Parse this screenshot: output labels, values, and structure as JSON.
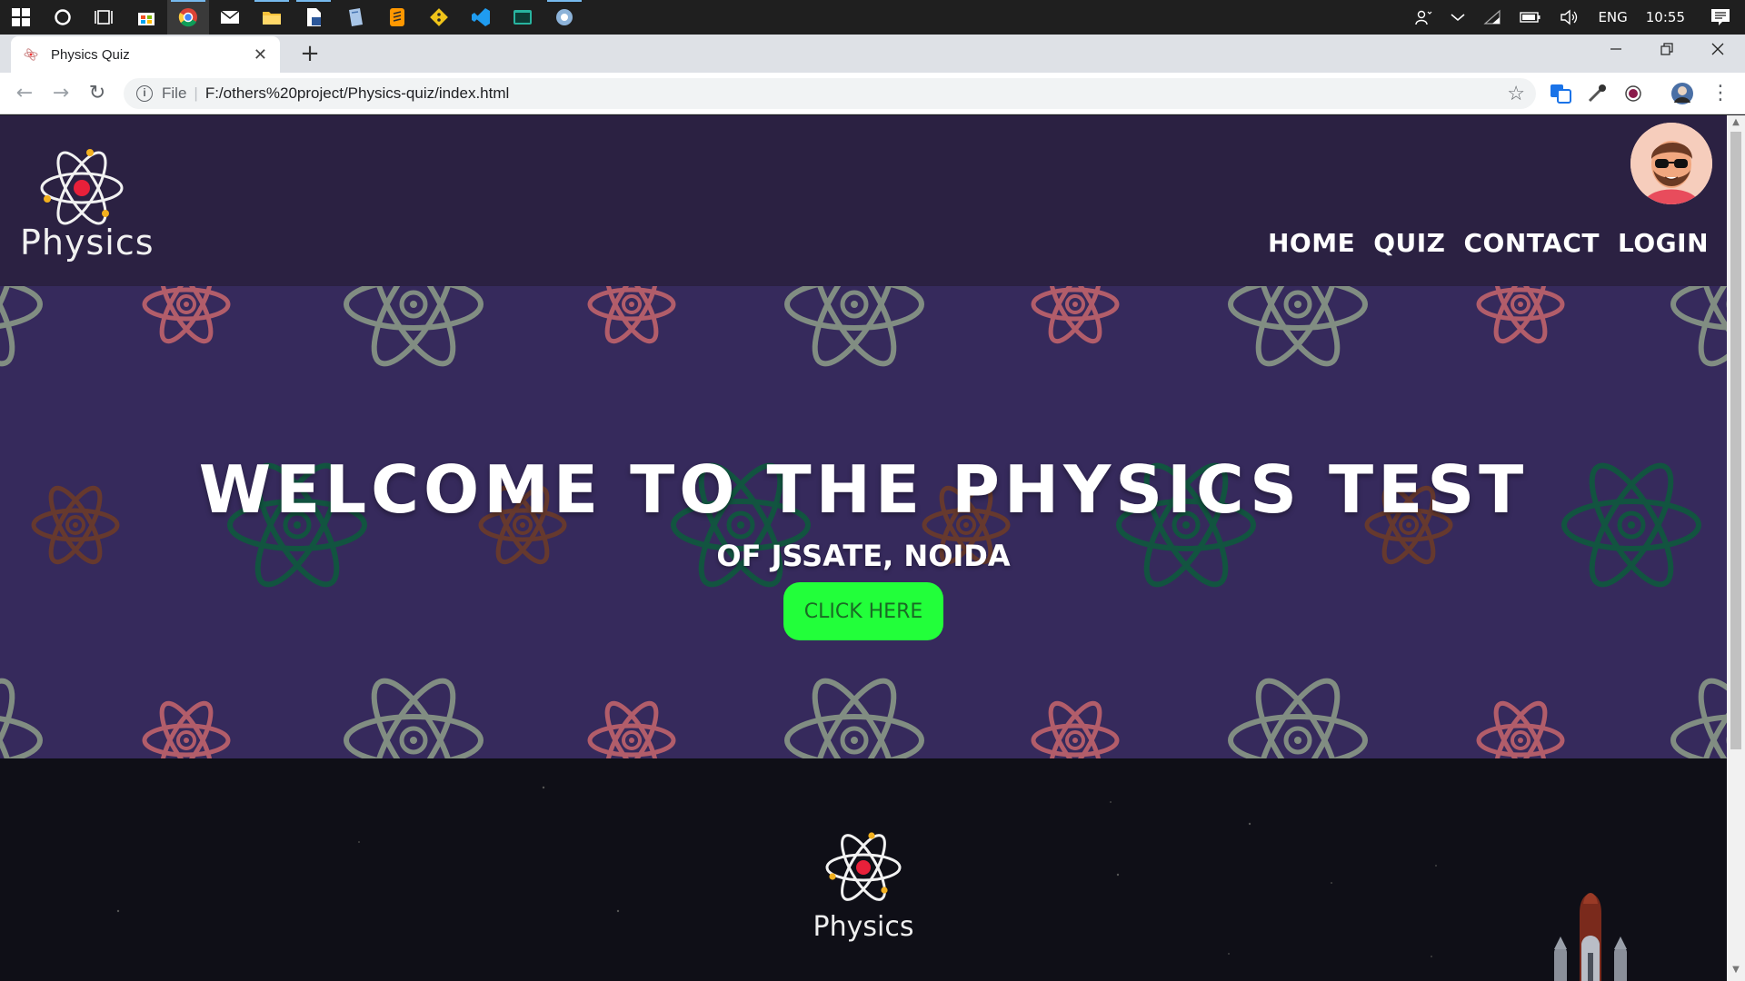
{
  "taskbar": {
    "apps": [
      {
        "icon": "windows-start-icon"
      },
      {
        "icon": "cortana-icon"
      },
      {
        "icon": "task-view-icon"
      },
      {
        "icon": "store-icon"
      },
      {
        "icon": "chrome-icon"
      },
      {
        "icon": "mail-icon"
      },
      {
        "icon": "file-explorer-icon"
      },
      {
        "icon": "document-app-icon"
      },
      {
        "icon": "notes-app-icon"
      },
      {
        "icon": "sublime-text-icon"
      },
      {
        "icon": "git-icon"
      },
      {
        "icon": "vscode-icon"
      },
      {
        "icon": "terminal-app-icon"
      },
      {
        "icon": "settings-app-icon"
      }
    ],
    "tray": {
      "language": "ENG",
      "time": "10:55"
    }
  },
  "browser": {
    "tab_title": "Physics Quiz",
    "address_scheme": "File",
    "address_url": "F:/others%20project/Physics-quiz/index.html"
  },
  "site": {
    "logo_text": "Physics",
    "nav": [
      "HOME",
      "QUIZ",
      "CONTACT",
      "LOGIN"
    ],
    "hero_title": "WELCOME TO THE PHYSICS TEST",
    "hero_subtitle": "OF JSSATE, NOIDA",
    "cta_label": "CLICK HERE",
    "footer_logo_text": "Physics"
  },
  "colors": {
    "header_bg": "#2b2142",
    "hero_bg": "#362a5c",
    "cta_bg": "#22ff3a",
    "footer_bg": "#0f0f17"
  }
}
